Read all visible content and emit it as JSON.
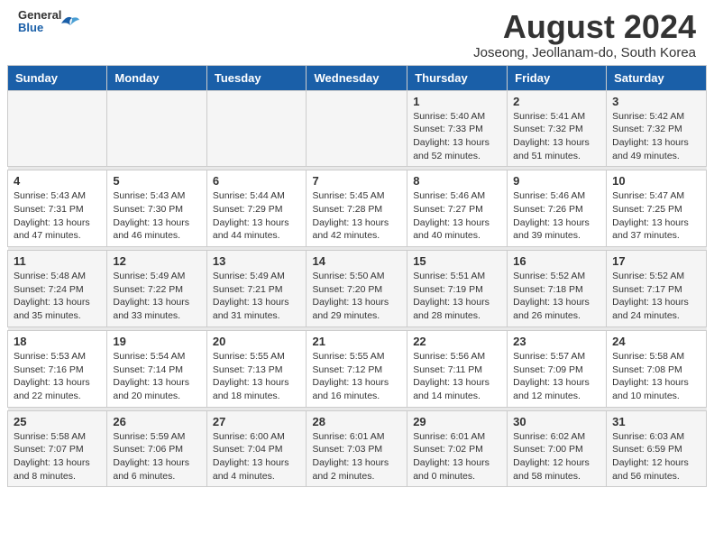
{
  "header": {
    "logo_line1": "General",
    "logo_line2": "Blue",
    "month_title": "August 2024",
    "location": "Joseong, Jeollanam-do, South Korea"
  },
  "weekdays": [
    "Sunday",
    "Monday",
    "Tuesday",
    "Wednesday",
    "Thursday",
    "Friday",
    "Saturday"
  ],
  "weeks": [
    [
      {
        "day": "",
        "empty": true
      },
      {
        "day": "",
        "empty": true
      },
      {
        "day": "",
        "empty": true
      },
      {
        "day": "",
        "empty": true
      },
      {
        "day": "1",
        "sunrise": "5:40 AM",
        "sunset": "7:33 PM",
        "daylight": "13 hours and 52 minutes."
      },
      {
        "day": "2",
        "sunrise": "5:41 AM",
        "sunset": "7:32 PM",
        "daylight": "13 hours and 51 minutes."
      },
      {
        "day": "3",
        "sunrise": "5:42 AM",
        "sunset": "7:32 PM",
        "daylight": "13 hours and 49 minutes."
      }
    ],
    [
      {
        "day": "4",
        "sunrise": "5:43 AM",
        "sunset": "7:31 PM",
        "daylight": "13 hours and 47 minutes."
      },
      {
        "day": "5",
        "sunrise": "5:43 AM",
        "sunset": "7:30 PM",
        "daylight": "13 hours and 46 minutes."
      },
      {
        "day": "6",
        "sunrise": "5:44 AM",
        "sunset": "7:29 PM",
        "daylight": "13 hours and 44 minutes."
      },
      {
        "day": "7",
        "sunrise": "5:45 AM",
        "sunset": "7:28 PM",
        "daylight": "13 hours and 42 minutes."
      },
      {
        "day": "8",
        "sunrise": "5:46 AM",
        "sunset": "7:27 PM",
        "daylight": "13 hours and 40 minutes."
      },
      {
        "day": "9",
        "sunrise": "5:46 AM",
        "sunset": "7:26 PM",
        "daylight": "13 hours and 39 minutes."
      },
      {
        "day": "10",
        "sunrise": "5:47 AM",
        "sunset": "7:25 PM",
        "daylight": "13 hours and 37 minutes."
      }
    ],
    [
      {
        "day": "11",
        "sunrise": "5:48 AM",
        "sunset": "7:24 PM",
        "daylight": "13 hours and 35 minutes."
      },
      {
        "day": "12",
        "sunrise": "5:49 AM",
        "sunset": "7:22 PM",
        "daylight": "13 hours and 33 minutes."
      },
      {
        "day": "13",
        "sunrise": "5:49 AM",
        "sunset": "7:21 PM",
        "daylight": "13 hours and 31 minutes."
      },
      {
        "day": "14",
        "sunrise": "5:50 AM",
        "sunset": "7:20 PM",
        "daylight": "13 hours and 29 minutes."
      },
      {
        "day": "15",
        "sunrise": "5:51 AM",
        "sunset": "7:19 PM",
        "daylight": "13 hours and 28 minutes."
      },
      {
        "day": "16",
        "sunrise": "5:52 AM",
        "sunset": "7:18 PM",
        "daylight": "13 hours and 26 minutes."
      },
      {
        "day": "17",
        "sunrise": "5:52 AM",
        "sunset": "7:17 PM",
        "daylight": "13 hours and 24 minutes."
      }
    ],
    [
      {
        "day": "18",
        "sunrise": "5:53 AM",
        "sunset": "7:16 PM",
        "daylight": "13 hours and 22 minutes."
      },
      {
        "day": "19",
        "sunrise": "5:54 AM",
        "sunset": "7:14 PM",
        "daylight": "13 hours and 20 minutes."
      },
      {
        "day": "20",
        "sunrise": "5:55 AM",
        "sunset": "7:13 PM",
        "daylight": "13 hours and 18 minutes."
      },
      {
        "day": "21",
        "sunrise": "5:55 AM",
        "sunset": "7:12 PM",
        "daylight": "13 hours and 16 minutes."
      },
      {
        "day": "22",
        "sunrise": "5:56 AM",
        "sunset": "7:11 PM",
        "daylight": "13 hours and 14 minutes."
      },
      {
        "day": "23",
        "sunrise": "5:57 AM",
        "sunset": "7:09 PM",
        "daylight": "13 hours and 12 minutes."
      },
      {
        "day": "24",
        "sunrise": "5:58 AM",
        "sunset": "7:08 PM",
        "daylight": "13 hours and 10 minutes."
      }
    ],
    [
      {
        "day": "25",
        "sunrise": "5:58 AM",
        "sunset": "7:07 PM",
        "daylight": "13 hours and 8 minutes."
      },
      {
        "day": "26",
        "sunrise": "5:59 AM",
        "sunset": "7:06 PM",
        "daylight": "13 hours and 6 minutes."
      },
      {
        "day": "27",
        "sunrise": "6:00 AM",
        "sunset": "7:04 PM",
        "daylight": "13 hours and 4 minutes."
      },
      {
        "day": "28",
        "sunrise": "6:01 AM",
        "sunset": "7:03 PM",
        "daylight": "13 hours and 2 minutes."
      },
      {
        "day": "29",
        "sunrise": "6:01 AM",
        "sunset": "7:02 PM",
        "daylight": "13 hours and 0 minutes."
      },
      {
        "day": "30",
        "sunrise": "6:02 AM",
        "sunset": "7:00 PM",
        "daylight": "12 hours and 58 minutes."
      },
      {
        "day": "31",
        "sunrise": "6:03 AM",
        "sunset": "6:59 PM",
        "daylight": "12 hours and 56 minutes."
      }
    ]
  ]
}
